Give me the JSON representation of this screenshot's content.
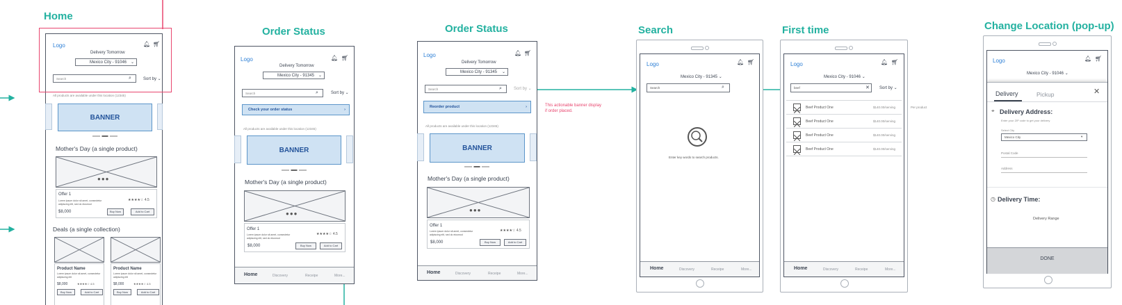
{
  "screens": {
    "home": {
      "title": "Home",
      "logo": "Logo",
      "delivery_label": "Delivery Tomorrow",
      "location_value": "Mexico City - 91046",
      "search_placeholder": "Search",
      "sort_label": "Sort by",
      "availability_note": "All products are available under this location (12345)",
      "banner_label": "BANNER",
      "section_mothers_day": "Mother's Day (a single product)",
      "offer_title": "Offer 1",
      "offer_desc": "Lorem ipsum dolor sit amet, consectetur adipiscing elit, sed do eiusmod",
      "offer_rating": "4.5",
      "offer_price": "$8,000",
      "buy_now": "Buy Now",
      "add_to_cart": "Add to Cart",
      "section_deals": "Deals (a single collection)",
      "product1_name": "Product Name",
      "product1_desc": "Lorem ipsum dolor sit amet, consectetur adipiscing elit",
      "product1_price": "$8,000",
      "product1_rating": "4.5",
      "product2_name": "Product Name",
      "product2_desc": "Lorem ipsum dolor sit amet, consectetur adipiscing elit",
      "product2_price": "$8,000",
      "product2_rating": "4.5"
    },
    "order_status_1": {
      "title": "Order Status",
      "logo": "Logo",
      "delivery_label": "Delivery Tomorrow",
      "location_value": "Mexico City - 91345",
      "search_placeholder": "Search",
      "sort_label": "Sort by",
      "promo_label": "Check your order status",
      "availability_note": "All products are available under this location (12345)",
      "banner_label": "BANNER",
      "section_mothers_day": "Mother's Day (a single product)",
      "offer_title": "Offer 1",
      "offer_desc": "Lorem ipsum dolor sit amet, consectetur adipiscing elit, sed do eiusmod",
      "offer_rating": "4.5",
      "offer_price": "$8,000",
      "buy_now": "Buy Now",
      "add_to_cart": "Add to Cart",
      "nav": [
        "Home",
        "Discovery",
        "Receipe",
        "More..."
      ]
    },
    "order_status_2": {
      "title": "Order Status",
      "logo": "Logo",
      "delivery_label": "Delivery Tomorrow",
      "location_value": "Mexico City - 91345",
      "search_placeholder": "Search",
      "sort_label": "Sort by",
      "promo_label": "Reorder product",
      "availability_note": "All products are available under this location (12345)",
      "banner_label": "BANNER",
      "section_mothers_day": "Mother's Day (a single product)",
      "offer_title": "Offer 1",
      "offer_desc": "Lorem ipsum dolor sit amet, consectetur adipiscing elit, sed do eiusmod",
      "offer_rating": "4.5",
      "offer_price": "$8,000",
      "buy_now": "Buy Now",
      "add_to_cart": "Add to Cart",
      "nav": [
        "Home",
        "Discovery",
        "Receipe",
        "More..."
      ],
      "annotation": "This actionable banner display\nif order placed."
    },
    "search": {
      "title": "Search",
      "logo": "Logo",
      "location_value": "Mexico City - 91345",
      "search_placeholder": "Search",
      "empty_message": "Enter key words to search products.",
      "nav": [
        "Home",
        "Discovery",
        "Receipe",
        "More..."
      ]
    },
    "first_time": {
      "title": "First time",
      "logo": "Logo",
      "location_value": "Mexico City - 91046",
      "search_value": "beef",
      "sort_label": "Sort by",
      "results": [
        {
          "name": "Beef Product One",
          "price": "$140.00/serving"
        },
        {
          "name": "Beef Product One",
          "price": "$140.00/serving"
        },
        {
          "name": "Beef Product One",
          "price": "$140.00/serving"
        },
        {
          "name": "Beef Product One",
          "price": "$140.00/serving"
        }
      ],
      "side_note": "Per product",
      "nav": [
        "Home",
        "Discovery",
        "Receipe",
        "More..."
      ]
    },
    "change_location": {
      "title": "Change Location (pop-up)",
      "logo": "Logo",
      "location_value": "Mexico City - 91046",
      "tab_delivery": "Delivery",
      "tab_pickup": "Pickup",
      "delivery_address_heading": "Delivery Address:",
      "zip_hint": "Enter your ZIP code to get your delivery",
      "city_label": "Select City",
      "city_value": "Mexico City",
      "postal_placeholder": "Postal Code",
      "address_placeholder": "Address",
      "delivery_time_heading": "Delivery Time:",
      "delivery_range": "Delivery Range",
      "done_label": "DONE"
    }
  },
  "colors": {
    "teal": "#23b1a0",
    "pink": "#e8456e",
    "banner": "#cfe2f3",
    "logo": "#2c7fd6"
  },
  "icons": [
    "bell-icon",
    "cart-icon",
    "search-icon",
    "chevron-down-icon",
    "close-icon",
    "location-pin-icon",
    "clock-icon",
    "arrow-icon"
  ]
}
